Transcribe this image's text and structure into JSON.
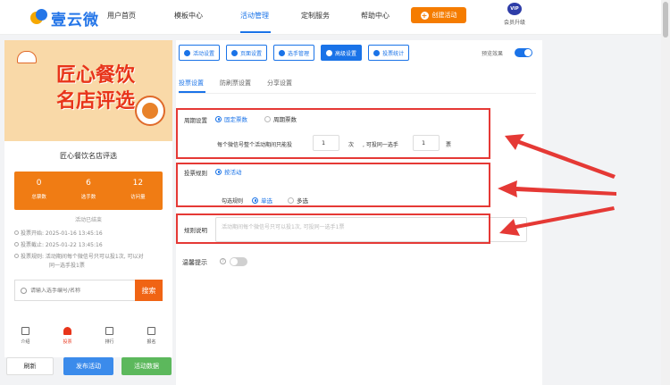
{
  "nav": {
    "logo_text": "壹云微",
    "items": [
      "用户首页",
      "模板中心",
      "活动管理",
      "定制服务",
      "帮助中心"
    ],
    "create_button": "创建活动",
    "vip_badge": "VIP",
    "vip_label": "会员升级"
  },
  "preview": {
    "banner_line1": "匠心餐饮",
    "banner_line2": "名店评选",
    "title": "匠心餐饮名店评选",
    "stats": [
      {
        "value": "0",
        "label": "总票数"
      },
      {
        "value": "6",
        "label": "选手数"
      },
      {
        "value": "12",
        "label": "访问量"
      }
    ],
    "ended": "活动已结束",
    "start_time": "投票开始: 2025-01-16 13:45:16",
    "end_time": "投票截止: 2025-01-22 13:45:16",
    "rule_text_1": "投票规则: 活动期间每个微信号只可以投1次, 可以对",
    "rule_text_2": "同一选手投1票",
    "search_placeholder": "请输入选手编号/名称",
    "search_button": "搜索",
    "tabs": [
      {
        "top": "",
        "label": "介绍"
      },
      {
        "top": "",
        "label": "投票"
      },
      {
        "top": "",
        "label": "排行"
      },
      {
        "top": "",
        "label": "报名"
      }
    ]
  },
  "bottom_buttons": {
    "refresh": "刷新",
    "publish": "发布活动",
    "data": "活动数据"
  },
  "toolbar": {
    "buttons": [
      "活动设置",
      "页面设置",
      "选手管理",
      "高级设置",
      "投票统计"
    ],
    "active_index": 3,
    "preview_label": "预览效果",
    "preview_on": true
  },
  "subtabs": [
    "投票设置",
    "防刷票设置",
    "分享设置"
  ],
  "settings": {
    "period_label": "周期设置",
    "period_options": [
      "固定票数",
      "周期票数"
    ],
    "period_text_1": "每个微信号整个活动期间只能投",
    "period_value_1": "1",
    "period_unit_1": "次",
    "period_text_2": ", 可投同一选手",
    "period_value_2": "1",
    "period_unit_2": "票",
    "rule_label": "投票规则",
    "rule_option": "按活动",
    "check_rule_label": "勾选规则",
    "check_options": [
      "单选",
      "多选"
    ],
    "desc_label": "规则说明",
    "desc_placeholder": "活动期间每个微信号只可以投1次, 可投同一选手1票",
    "tip_label": "温馨提示",
    "tip_help": "?"
  },
  "colors": {
    "accent": "#1a73e8",
    "orange": "#f57c00",
    "highlight_red": "#e53935"
  }
}
